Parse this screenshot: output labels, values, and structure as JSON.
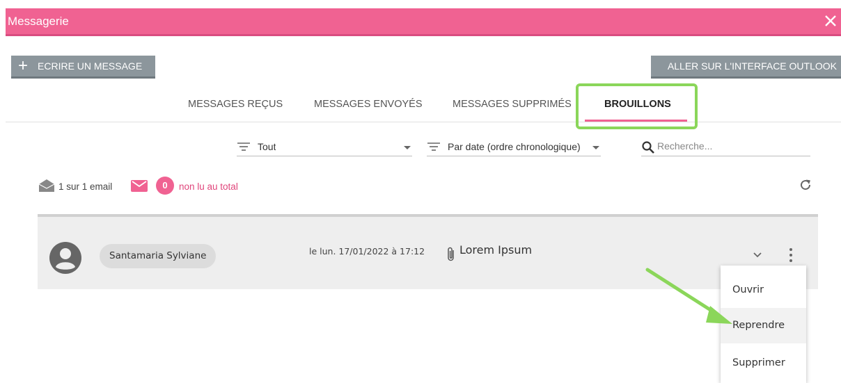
{
  "window": {
    "title": "Messagerie",
    "close_icon": "close-icon"
  },
  "toolbar": {
    "write_label": "ECRIRE UN MESSAGE",
    "outlook_label": "ALLER SUR L'INTERFACE OUTLOOK"
  },
  "tabs": [
    {
      "label": "MESSAGES REÇUS",
      "active": false
    },
    {
      "label": "MESSAGES ENVOYÉS",
      "active": false
    },
    {
      "label": "MESSAGES SUPPRIMÉS",
      "active": false
    },
    {
      "label": "BROUILLONS",
      "active": true
    }
  ],
  "filters": {
    "type_value": "Tout",
    "sort_value": "Par date (ordre chronologique)",
    "search_placeholder": "Recherche..."
  },
  "counts": {
    "total_text": "1 sur 1 email",
    "unread_count": "0",
    "unread_text": "non lu au total"
  },
  "message": {
    "sender": "Santamaria Sylviane",
    "date": "le lun. 17/01/2022 à 17:12",
    "subject": "Lorem Ipsum",
    "has_attachment": true
  },
  "context_menu": {
    "items": [
      "Ouvrir",
      "Reprendre",
      "Supprimer"
    ]
  },
  "colors": {
    "accent": "#f06292",
    "highlight": "#8bd65a",
    "button_grey": "#8c969c"
  }
}
